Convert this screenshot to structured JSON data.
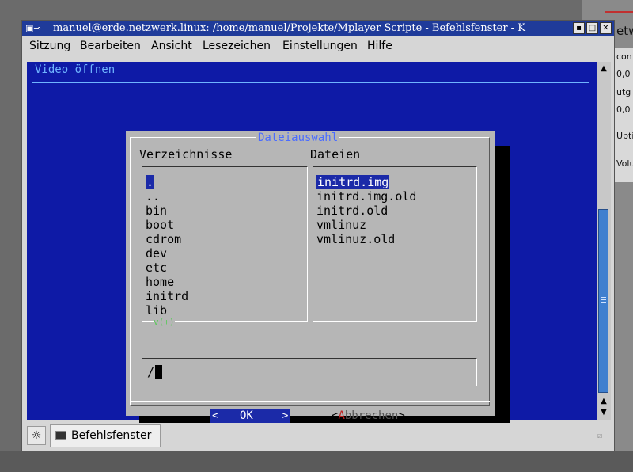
{
  "background": {
    "panel_labels": [
      "con",
      "0,0",
      "utg",
      "0,0",
      "Upti",
      "Volu"
    ],
    "partial_title": "etw"
  },
  "window": {
    "title": "manuel@erde.netzwerk.linux: /home/manuel/Projekte/Mplayer Scripte - Befehlsfenster - K",
    "buttons": {
      "minimize": "▪",
      "maximize": "□",
      "close": "✕"
    },
    "icon": "terminal-icon"
  },
  "menubar": {
    "items": [
      "Sitzung",
      "Bearbeiten",
      "Ansicht",
      "Lesezeichen",
      "Einstellungen",
      "Hilfe"
    ]
  },
  "terminal": {
    "title": "Video öffnen"
  },
  "dialog": {
    "title": "Dateiauswahl",
    "dirs_label": "Verzeichnisse",
    "files_label": "Dateien",
    "directories": [
      ".",
      "..",
      "bin",
      "boot",
      "cdrom",
      "dev",
      "etc",
      "home",
      "initrd",
      "lib"
    ],
    "files": [
      "initrd.img",
      "initrd.img.old",
      "initrd.old",
      "vmlinuz",
      "vmlinuz.old"
    ],
    "more_indicator": "v(+)",
    "path": "/",
    "ok_button": {
      "left": "<",
      "label": "OK",
      "right": ">"
    },
    "cancel_button": {
      "open": "<",
      "hotkey": "A",
      "rest": "bbrechen",
      "close": ">"
    }
  },
  "statusbar": {
    "task_label": "Befehlsfenster"
  },
  "colors": {
    "terminal_bg": "#0e1aa6",
    "title_bar": "#1f3b9a",
    "dialog_bg": "#b6b6b6",
    "selection": "#1b2aa8",
    "dialog_title": "#4a6cff"
  }
}
